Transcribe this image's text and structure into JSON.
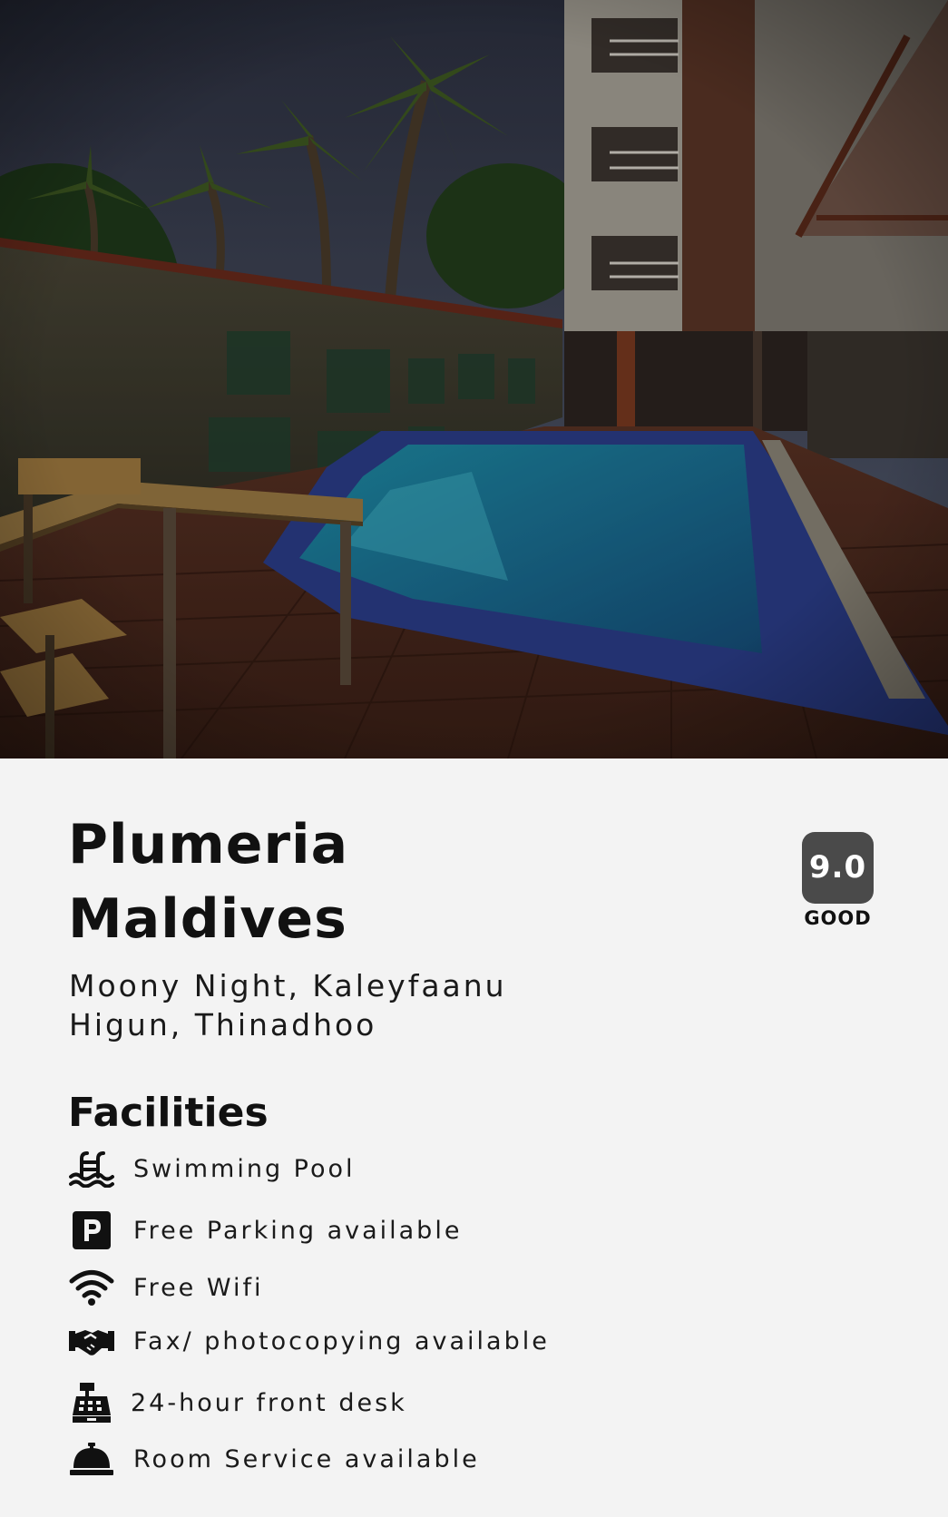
{
  "hotel": {
    "name": "Plumeria Maldives",
    "address": "Moony Night, Kaleyfaanu Higun, Thinadhoo"
  },
  "rating": {
    "score": "9.0",
    "label": "GOOD"
  },
  "facilities": {
    "heading": "Facilities",
    "items": [
      {
        "icon": "swimming-pool-icon",
        "label": "Swimming Pool"
      },
      {
        "icon": "parking-icon",
        "label": "Free Parking available"
      },
      {
        "icon": "wifi-icon",
        "label": "Free Wifi"
      },
      {
        "icon": "handshake-icon",
        "label": "Fax/ photocopying available"
      },
      {
        "icon": "cash-register-icon",
        "label": "24-hour front desk"
      },
      {
        "icon": "service-bell-icon",
        "label": "Room Service available"
      }
    ]
  },
  "colors": {
    "background": "#f3f3f3",
    "rating_badge": "#4a4a4a",
    "text": "#111111"
  }
}
